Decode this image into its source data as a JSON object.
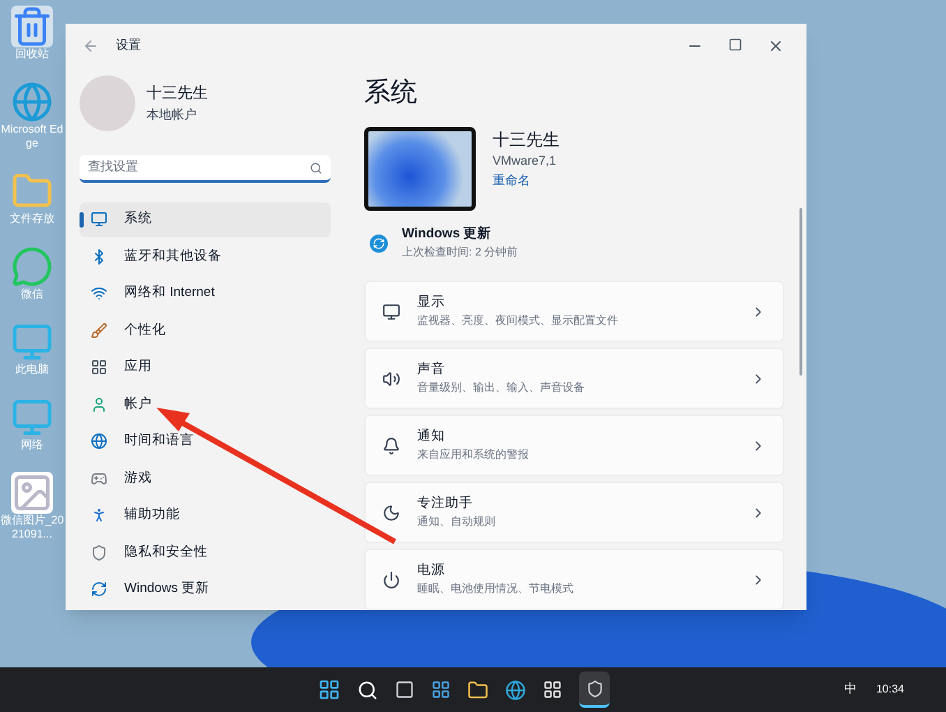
{
  "desktop_icons": [
    {
      "label": "回收站"
    },
    {
      "label": "Microsoft Edge"
    },
    {
      "label": "文件存放"
    },
    {
      "label": "微信"
    },
    {
      "label": "此电脑"
    },
    {
      "label": "网络"
    },
    {
      "label": "微信图片_2021091..."
    }
  ],
  "window": {
    "title": "设置"
  },
  "profile": {
    "name": "十三先生",
    "account_type": "本地帐户"
  },
  "search": {
    "placeholder": "查找设置"
  },
  "nav_items": [
    {
      "label": "系统",
      "selected": true
    },
    {
      "label": "蓝牙和其他设备",
      "selected": false
    },
    {
      "label": "网络和 Internet",
      "selected": false
    },
    {
      "label": "个性化",
      "selected": false
    },
    {
      "label": "应用",
      "selected": false
    },
    {
      "label": "帐户",
      "selected": false
    },
    {
      "label": "时间和语言",
      "selected": false
    },
    {
      "label": "游戏",
      "selected": false
    },
    {
      "label": "辅助功能",
      "selected": false
    },
    {
      "label": "隐私和安全性",
      "selected": false
    },
    {
      "label": "Windows 更新",
      "selected": false
    }
  ],
  "page_title": "系统",
  "device": {
    "name": "十三先生",
    "model": "VMware7,1",
    "rename_link": "重命名"
  },
  "update": {
    "title": "Windows 更新",
    "subtitle": "上次检查时间: 2 分钟前"
  },
  "setting_cards": [
    {
      "title": "显示",
      "subtitle": "监视器、亮度、夜间模式、显示配置文件"
    },
    {
      "title": "声音",
      "subtitle": "音量级别、输出、输入、声音设备"
    },
    {
      "title": "通知",
      "subtitle": "来自应用和系统的警报"
    },
    {
      "title": "专注助手",
      "subtitle": "通知、自动规则"
    },
    {
      "title": "电源",
      "subtitle": "睡眠、电池使用情况、节电模式"
    }
  ],
  "taskbar": {
    "ime": "中",
    "clock": "10:34"
  }
}
